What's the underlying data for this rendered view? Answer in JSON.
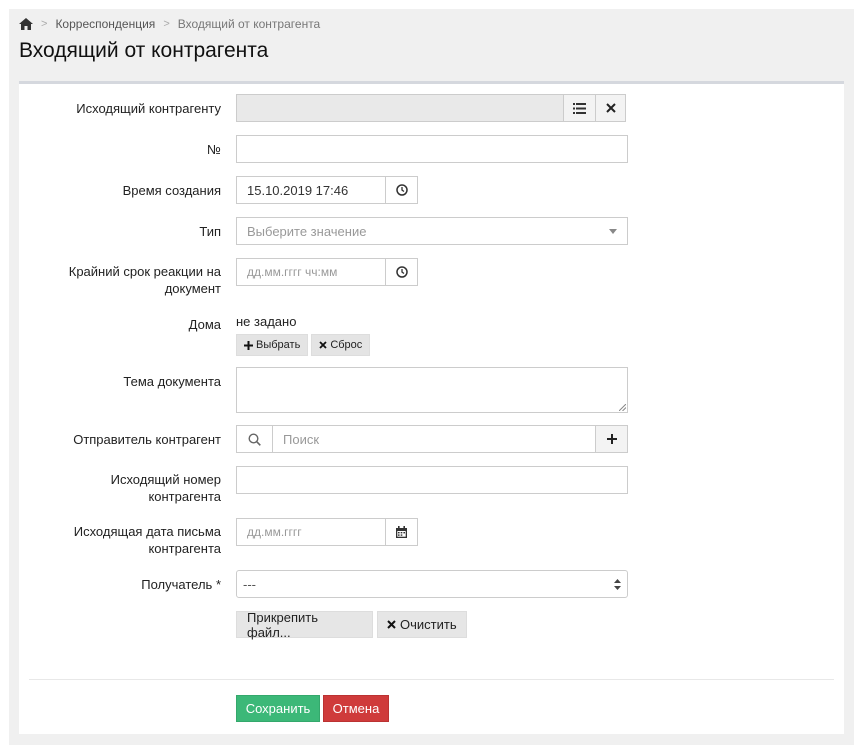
{
  "breadcrumb": {
    "home_icon": "home-icon",
    "items": [
      "Корреспонденция",
      "Входящий от контрагента"
    ]
  },
  "page_title": "Входящий от контрагента",
  "form": {
    "outgoing_counterparty": {
      "label": "Исходящий контрагенту",
      "value": ""
    },
    "number": {
      "label": "№",
      "value": ""
    },
    "created_time": {
      "label": "Время создания",
      "value": "15.10.2019 17:46"
    },
    "type": {
      "label": "Тип",
      "placeholder": "Выберите значение"
    },
    "deadline": {
      "label_line1": "Крайний срок реакции на",
      "label_line2": "документ",
      "placeholder": "дд.мм.гггг чч:мм"
    },
    "houses": {
      "label": "Дома",
      "value": "не задано",
      "choose_label": "Выбрать",
      "reset_label": "Сброс"
    },
    "subject": {
      "label": "Тема документа",
      "value": ""
    },
    "sender": {
      "label": "Отправитель контрагент",
      "placeholder": "Поиск"
    },
    "outgoing_number": {
      "label_line1": "Исходящий номер",
      "label_line2": "контрагента",
      "value": ""
    },
    "outgoing_date": {
      "label_line1": "Исходящая дата письма",
      "label_line2": "контрагента",
      "placeholder": "дд.мм.гггг"
    },
    "recipient": {
      "label": "Получатель",
      "required_mark": "*",
      "value": "---"
    },
    "attach_label": "Прикрепить файл...",
    "clear_label": "Очистить"
  },
  "actions": {
    "save_label": "Сохранить",
    "cancel_label": "Отмена"
  },
  "colors": {
    "save": "#3cb878",
    "cancel": "#cf3b3b",
    "background": "#f0f0f0"
  }
}
